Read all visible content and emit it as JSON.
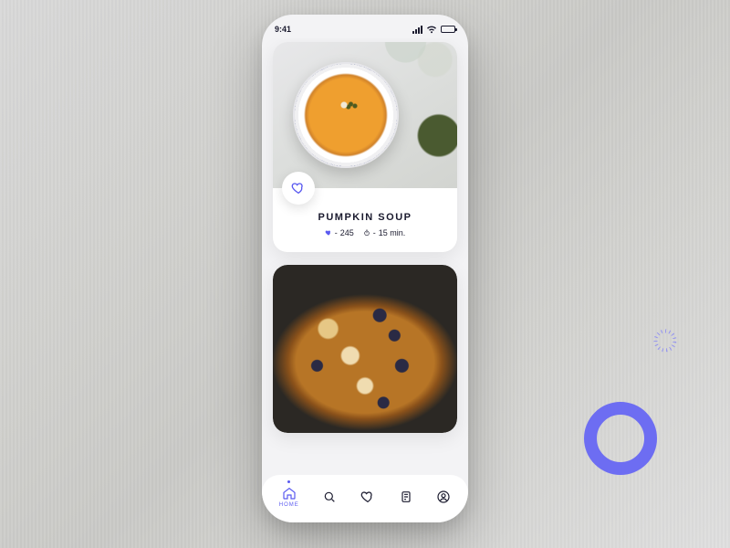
{
  "status": {
    "time": "9:41"
  },
  "cards": [
    {
      "title": "PUMPKIN SOUP",
      "likes_prefix": "- ",
      "likes": "245",
      "time_prefix": "- ",
      "time": "15 min."
    }
  ],
  "tabs": {
    "home": "HOME"
  },
  "colors": {
    "accent": "#6d6df2",
    "ink": "#1a1a2e"
  }
}
